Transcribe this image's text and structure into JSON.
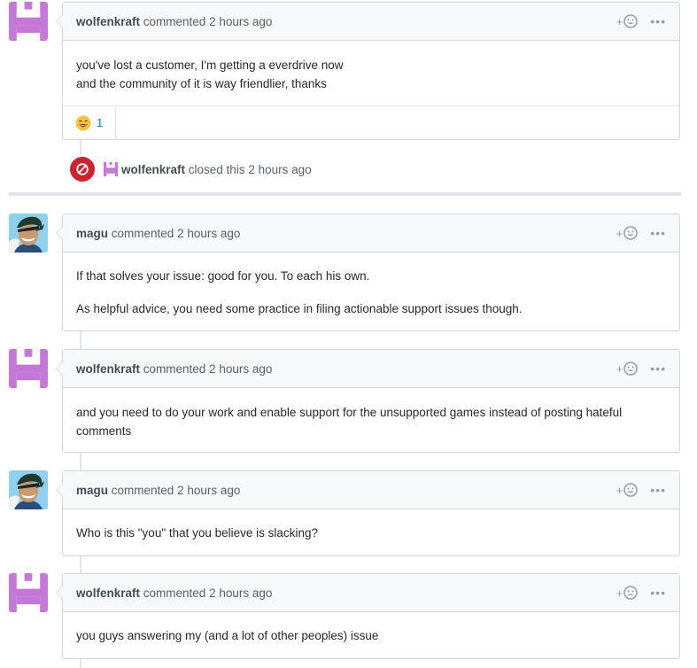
{
  "colors": {
    "accent": "#0366d6",
    "closed_badge": "#cb2431",
    "identicon": "#c577d7",
    "border": "#d1d5da",
    "header_bg": "#f6f8fa"
  },
  "comments": [
    {
      "author": "wolfenkraft",
      "action": "commented",
      "time": "2 hours ago",
      "avatar": "identicon",
      "body": [
        "you've lost a customer, I'm getting a everdrive now",
        "and the community of it is way friendlier, thanks"
      ],
      "reaction": {
        "emoji": "😄",
        "icon": "smile-emoji-icon",
        "count": "1"
      }
    },
    {
      "author": "magu",
      "action": "commented",
      "time": "2 hours ago",
      "avatar": "anime-character",
      "body": [
        "If that solves your issue: good for you. To each his own.",
        "As helpful advice, you need some practice in filing actionable support issues though."
      ]
    },
    {
      "author": "wolfenkraft",
      "action": "commented",
      "time": "2 hours ago",
      "avatar": "identicon",
      "body": [
        "and you need to do your work and enable support for the unsupported games instead of posting hateful comments"
      ]
    },
    {
      "author": "magu",
      "action": "commented",
      "time": "2 hours ago",
      "avatar": "anime-character",
      "body": [
        "Who is this \"you\" that you believe is slacking?"
      ]
    },
    {
      "author": "wolfenkraft",
      "action": "commented",
      "time": "2 hours ago",
      "avatar": "identicon",
      "body": [
        "you guys answering my (and a lot of other peoples) issue"
      ]
    }
  ],
  "event": {
    "author": "wolfenkraft",
    "action": "closed this",
    "time": "2 hours ago",
    "icon": "circle-slash-icon"
  },
  "header_actions": {
    "react_icon": "add-reaction-icon",
    "react_plus": "+",
    "more_icon": "kebab-horizontal-icon",
    "more_label": "•••"
  }
}
